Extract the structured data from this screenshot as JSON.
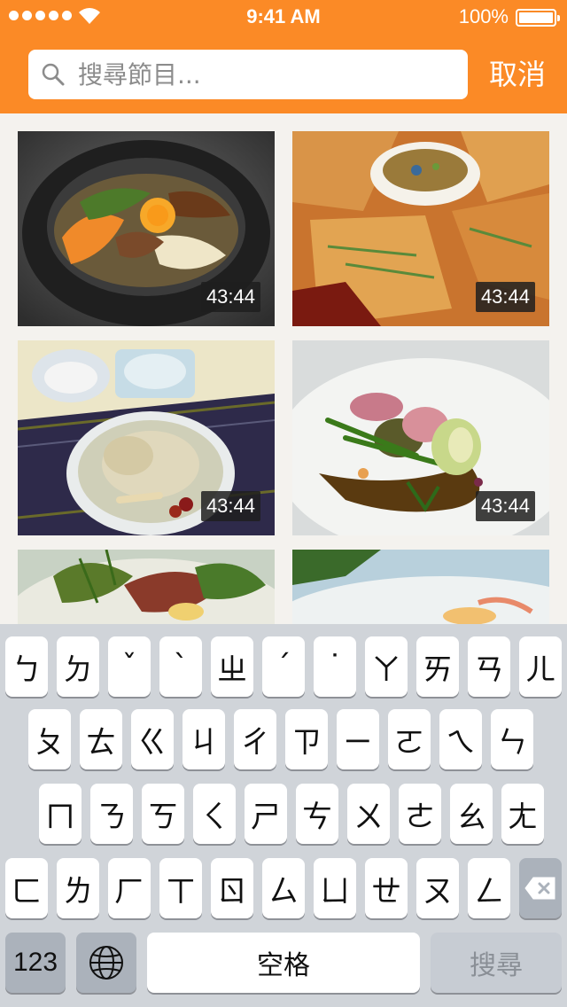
{
  "status_bar": {
    "time": "9:41 AM",
    "battery": "100%",
    "signal_bars": 5
  },
  "search": {
    "placeholder": "搜尋節目...",
    "cancel_label": "取消"
  },
  "results": [
    {
      "duration": "43:44",
      "image": "bibimbap"
    },
    {
      "duration": "43:44",
      "image": "pajeon"
    },
    {
      "duration": "43:44",
      "image": "samgyetang"
    },
    {
      "duration": "43:44",
      "image": "plated-dish"
    },
    {
      "duration": "",
      "image": "salad"
    },
    {
      "duration": "",
      "image": "seafood-plate"
    }
  ],
  "keyboard": {
    "row1": [
      "ㄅ",
      "ㄉ",
      "ˇ",
      "ˋ",
      "ㄓ",
      "ˊ",
      "˙",
      "ㄚ",
      "ㄞ",
      "ㄢ",
      "ㄦ"
    ],
    "row2": [
      "ㄆ",
      "ㄊ",
      "ㄍ",
      "ㄐ",
      "ㄔ",
      "ㄗ",
      "ㄧ",
      "ㄛ",
      "ㄟ",
      "ㄣ"
    ],
    "row3": [
      "ㄇ",
      "ㄋ",
      "ㄎ",
      "ㄑ",
      "ㄕ",
      "ㄘ",
      "ㄨ",
      "ㄜ",
      "ㄠ",
      "ㄤ"
    ],
    "row4": [
      "ㄈ",
      "ㄌ",
      "ㄏ",
      "ㄒ",
      "ㄖ",
      "ㄙ",
      "ㄩ",
      "ㄝ",
      "ㄡ",
      "ㄥ"
    ],
    "numbers_label": "123",
    "space_label": "空格",
    "search_label": "搜尋"
  },
  "colors": {
    "accent": "#fb8a26",
    "keyboard_bg": "#d0d4d9"
  }
}
